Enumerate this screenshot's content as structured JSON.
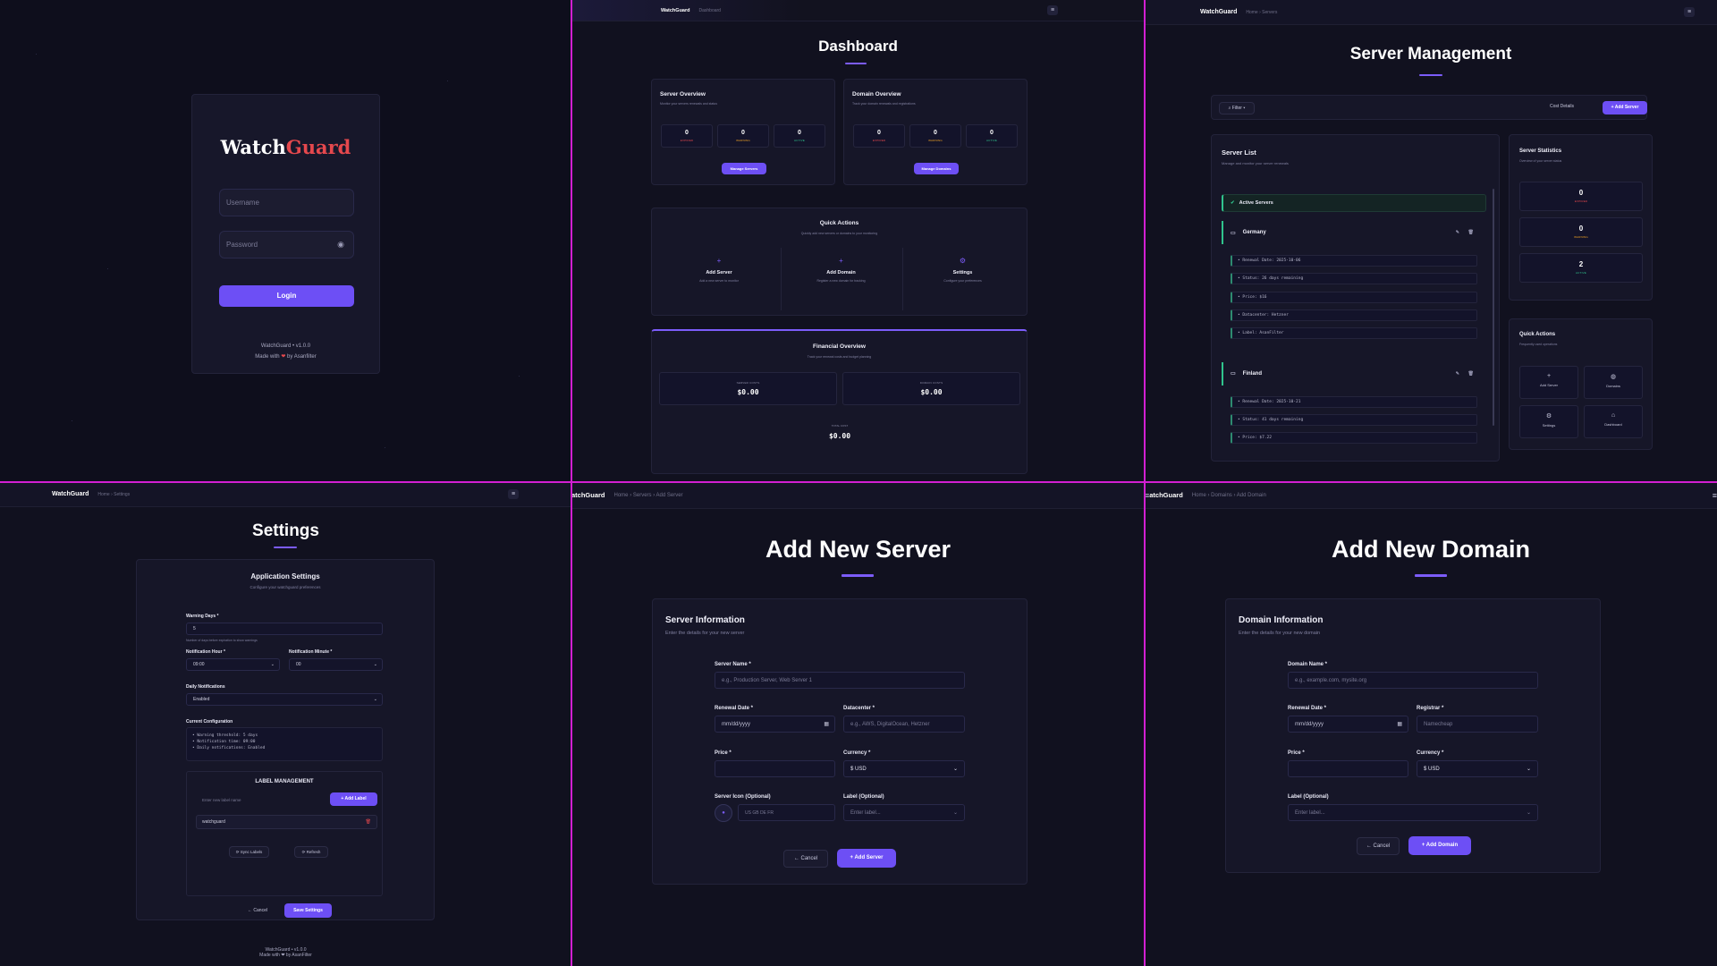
{
  "login": {
    "brand_part1": "Watch",
    "brand_part2": "Guard",
    "username_placeholder": "Username",
    "password_placeholder": "Password",
    "login_label": "Login",
    "version": "WatchGuard • v1.0.0",
    "made_with_prefix": "Made with",
    "made_by": "by Asanfilter"
  },
  "dashboard": {
    "brand": "WatchGuard",
    "crumb": "Dashboard",
    "title": "Dashboard",
    "server_overview": {
      "title": "Server Overview",
      "subtitle": "Monitor your servers renewals and status",
      "stats": [
        {
          "value": "0",
          "label": "EXPIRED",
          "color": "#e5484d"
        },
        {
          "value": "0",
          "label": "WARNING",
          "color": "#f5a623"
        },
        {
          "value": "0",
          "label": "ACTIVE",
          "color": "#30c48d"
        }
      ],
      "button": "Manage Servers"
    },
    "domain_overview": {
      "title": "Domain Overview",
      "subtitle": "Track your domain renewals and registrations",
      "stats": [
        {
          "value": "0",
          "label": "EXPIRED",
          "color": "#e5484d"
        },
        {
          "value": "0",
          "label": "WARNING",
          "color": "#f5a623"
        },
        {
          "value": "0",
          "label": "ACTIVE",
          "color": "#30c48d"
        }
      ],
      "button": "Manage Domains"
    },
    "quick_actions": {
      "title": "Quick Actions",
      "subtitle": "Quickly add new servers or domains to your monitoring",
      "items": [
        {
          "icon": "plus-icon",
          "glyph": "+",
          "title": "Add Server",
          "desc": "Add a new server to monitor"
        },
        {
          "icon": "plus-icon",
          "glyph": "+",
          "title": "Add Domain",
          "desc": "Register a new domain for tracking"
        },
        {
          "icon": "gear-icon",
          "glyph": "⚙",
          "title": "Settings",
          "desc": "Configure your preferences"
        }
      ]
    },
    "financial": {
      "title": "Financial Overview",
      "subtitle": "Track your renewal costs and budget planning",
      "server_costs_label": "SERVER COSTS",
      "server_costs_value": "$0.00",
      "domain_costs_label": "DOMAIN COSTS",
      "domain_costs_value": "$0.00",
      "total_label": "TOTAL COST",
      "total_value": "$0.00"
    }
  },
  "servers": {
    "brand": "WatchGuard",
    "crumb": "Home › Servers",
    "title": "Server Management",
    "filter": "Filter ▾",
    "cost_details": "Cost Details",
    "add_server": "+ Add Server",
    "list_title": "Server List",
    "list_subtitle": "Manage and monitor your server renewals",
    "active_label": "Active Servers",
    "entries": [
      {
        "name": "Germany",
        "details": [
          "• Renewal Date: 2025-10-06",
          "• Status: 26 days remaining",
          "• Price: $16",
          "• Datacenter: Hetzner",
          "• Label: AsanFilter"
        ]
      },
      {
        "name": "Finland",
        "details": [
          "• Renewal Date: 2025-10-21",
          "• Status: 41 days remaining",
          "• Price: $7.22"
        ]
      }
    ],
    "stats_title": "Server Statistics",
    "stats_subtitle": "Overview of your server status",
    "stats": [
      {
        "value": "0",
        "label": "EXPIRED",
        "color": "#e5484d"
      },
      {
        "value": "0",
        "label": "WARNING",
        "color": "#f5a623"
      },
      {
        "value": "2",
        "label": "ACTIVE",
        "color": "#30c48d"
      }
    ],
    "qa_title": "Quick Actions",
    "qa_subtitle": "Frequently used operations",
    "qa_items": [
      {
        "icon": "plus-icon",
        "glyph": "+",
        "label": "Add Server"
      },
      {
        "icon": "globe-icon",
        "glyph": "◍",
        "label": "Domains"
      },
      {
        "icon": "gear-icon",
        "glyph": "⚙",
        "label": "Settings"
      },
      {
        "icon": "home-icon",
        "glyph": "⌂",
        "label": "Dashboard"
      }
    ]
  },
  "settings": {
    "brand": "WatchGuard",
    "crumb": "Home › Settings",
    "title": "Settings",
    "card_title": "Application Settings",
    "card_subtitle": "Configure your watchguard preferences",
    "warning_days_label": "Warning Days *",
    "warning_days_value": "5",
    "warning_days_help": "Number of days before expiration to show warnings",
    "notif_hour_label": "Notification Hour *",
    "notif_hour_value": "09:00",
    "notif_minute_label": "Notification Minute *",
    "notif_minute_value": "00",
    "daily_label": "Daily Notifications",
    "daily_value": "Enabled",
    "current_config_label": "Current Configuration",
    "config_lines": [
      "• Warning threshold: 5 days",
      "• Notification time: 09:00",
      "• Daily notifications: Enabled"
    ],
    "label_mgmt_title": "LABEL MANAGEMENT",
    "new_label_placeholder": "Enter new label name",
    "add_label": "+ Add Label",
    "labels": [
      "watchguard"
    ],
    "sync_labels": "⟳ Sync Labels",
    "refresh": "⟳ Refresh",
    "cancel": "← Cancel",
    "save": "Save Settings",
    "footer_version": "WatchGuard • v1.0.0",
    "footer_made": "Made with ❤ by AsanFilter"
  },
  "add_server": {
    "brand": "atchGuard",
    "crumb": "Home › Servers › Add Server",
    "title": "Add New Server",
    "card_title": "Server Information",
    "card_subtitle": "Enter the details for your new server",
    "name_label": "Server Name *",
    "name_placeholder": "e.g., Production Server, Web Server 1",
    "renewal_label": "Renewal Date *",
    "renewal_placeholder": "mm/dd/yyyy",
    "datacenter_label": "Datacenter *",
    "datacenter_placeholder": "e.g., AWS, DigitalOcean, Hetzner",
    "price_label": "Price *",
    "currency_label": "Currency *",
    "currency_value": "$ USD",
    "icon_label": "Server Icon (Optional)",
    "icon_placeholder": "US GB DE FR",
    "label_label": "Label (Optional)",
    "label_placeholder": "Enter label...",
    "cancel": "← Cancel",
    "submit": "+ Add Server"
  },
  "add_domain": {
    "brand": "atchGuard",
    "crumb": "Home › Domains › Add Domain",
    "title": "Add New Domain",
    "card_title": "Domain Information",
    "card_subtitle": "Enter the details for your new domain",
    "name_label": "Domain Name *",
    "name_placeholder": "e.g., example.com, mysite.org",
    "renewal_label": "Renewal Date *",
    "renewal_placeholder": "mm/dd/yyyy",
    "registrar_label": "Registrar *",
    "registrar_placeholder": "Namecheap",
    "price_label": "Price *",
    "currency_label": "Currency *",
    "currency_value": "$ USD",
    "label_label": "Label (Optional)",
    "label_placeholder": "Enter label...",
    "cancel": "← Cancel",
    "submit": "+ Add Domain"
  },
  "colors": {
    "accent": "#6d4ff5",
    "brand_red": "#e5484d",
    "divider": "#d21fd2"
  }
}
